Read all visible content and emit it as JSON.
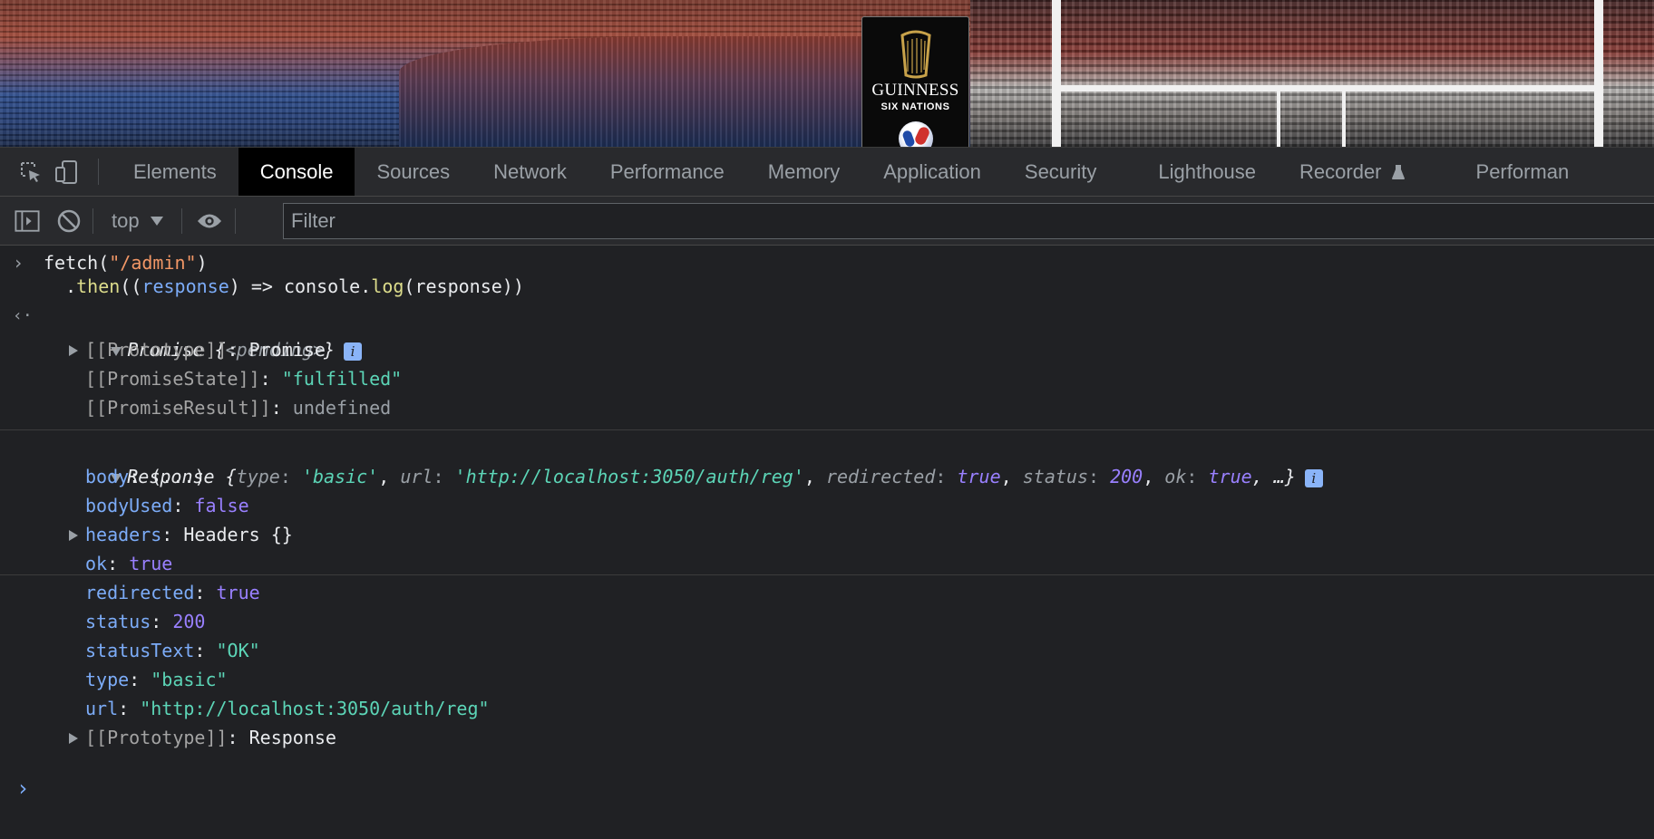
{
  "banner": {
    "logo_brand": "GUINNESS",
    "logo_sub": "SIX NATIONS"
  },
  "tabs": [
    {
      "label": "Elements",
      "active": false
    },
    {
      "label": "Console",
      "active": true
    },
    {
      "label": "Sources",
      "active": false
    },
    {
      "label": "Network",
      "active": false
    },
    {
      "label": "Performance",
      "active": false
    },
    {
      "label": "Memory",
      "active": false
    },
    {
      "label": "Application",
      "active": false
    },
    {
      "label": "Security",
      "active": false
    },
    {
      "label": "Lighthouse",
      "active": false
    },
    {
      "label": "Recorder",
      "active": false
    },
    {
      "label": "Performan",
      "active": false
    }
  ],
  "toolbar": {
    "context": "top",
    "filter_placeholder": "Filter"
  },
  "console": {
    "input_line1_fn": "fetch",
    "input_line1_open": "(",
    "input_line1_arg": "\"/admin\"",
    "input_line1_close": ")",
    "input_line2_dot": ".",
    "input_line2_then": "then",
    "input_line2_open": "((",
    "input_line2_param": "response",
    "input_line2_arrow": ") => console.",
    "input_line2_log": "log",
    "input_line2_rest": "(response))",
    "promise_label": "Promise {",
    "promise_pending": "<pending>",
    "promise_close": "}",
    "promise_props": [
      {
        "key": "[[Prototype]]",
        "sep": ": ",
        "value": "Promise",
        "expandable": true,
        "vclass": "c-white"
      },
      {
        "key": "[[PromiseState]]",
        "sep": ": ",
        "value": "\"fulfilled\"",
        "expandable": false,
        "vclass": "c-str"
      },
      {
        "key": "[[PromiseResult]]",
        "sep": ": ",
        "value": "undefined",
        "expandable": false,
        "vclass": "c-grey"
      }
    ],
    "response_head": {
      "label": "Response {",
      "k_type": "type",
      "v_type": "'basic'",
      "k_url": "url",
      "v_url": "'http://localhost:3050/auth/reg'",
      "k_redirected": "redirected",
      "v_redirected": "true",
      "k_status": "status",
      "v_status": "200",
      "k_ok": "ok",
      "v_ok": "true",
      "tail": ", …}"
    },
    "response_props": [
      {
        "key": "body",
        "sep": ": ",
        "value": "(...)",
        "expandable": false,
        "vclass": "c-white"
      },
      {
        "key": "bodyUsed",
        "sep": ": ",
        "value": "false",
        "expandable": false,
        "vclass": "c-purple"
      },
      {
        "key": "headers",
        "sep": ": ",
        "value": "Headers {}",
        "expandable": true,
        "vclass": "c-white"
      },
      {
        "key": "ok",
        "sep": ": ",
        "value": "true",
        "expandable": false,
        "vclass": "c-purple"
      },
      {
        "key": "redirected",
        "sep": ": ",
        "value": "true",
        "expandable": false,
        "vclass": "c-purple"
      },
      {
        "key": "status",
        "sep": ": ",
        "value": "200",
        "expandable": false,
        "vclass": "c-purple"
      },
      {
        "key": "statusText",
        "sep": ": ",
        "value": "\"OK\"",
        "expandable": false,
        "vclass": "c-str"
      },
      {
        "key": "type",
        "sep": ": ",
        "value": "\"basic\"",
        "expandable": false,
        "vclass": "c-str"
      },
      {
        "key": "url",
        "sep": ": ",
        "value": "\"http://localhost:3050/auth/reg\"",
        "expandable": false,
        "vclass": "c-str"
      },
      {
        "key": "[[Prototype]]",
        "sep": ": ",
        "value": "Response",
        "expandable": true,
        "vclass": "c-white"
      }
    ]
  }
}
